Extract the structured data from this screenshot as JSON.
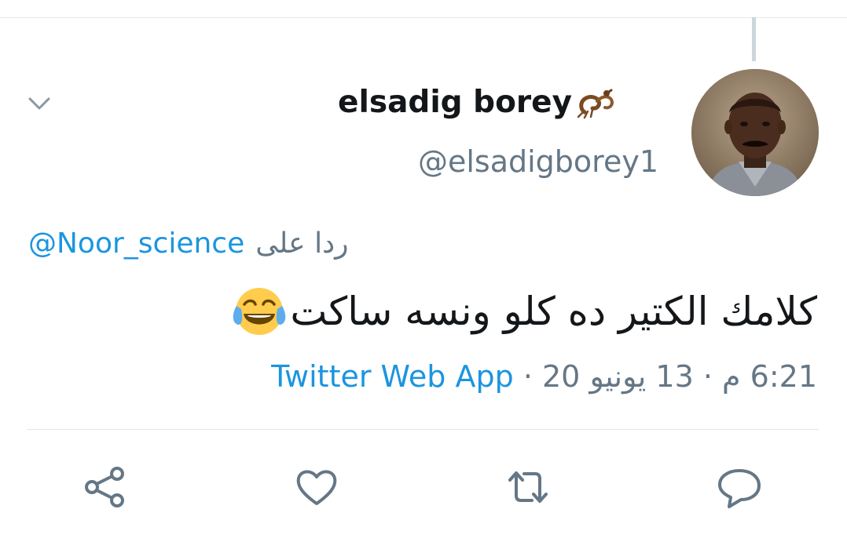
{
  "tweet": {
    "display_name": "elsadig borey",
    "handle": "@elsadigborey1",
    "reply_prefix": "ردا على",
    "reply_to": "@Noor_science",
    "text": "كلامك الكتير ده كلو ونسه ساكت",
    "time": "6:21 م",
    "date": "13 يونيو 20",
    "source": "Twitter Web App",
    "separator": "·",
    "name_badge_icon": "scorpion-icon",
    "text_emoji_icon": "face-with-tears-of-joy-icon"
  },
  "actions": [
    {
      "name": "share-icon"
    },
    {
      "name": "like-heart-icon"
    },
    {
      "name": "retweet-icon"
    },
    {
      "name": "reply-bubble-icon"
    }
  ],
  "colors": {
    "link": "#1b95e0",
    "secondary_text": "#657786",
    "primary_text": "#14171a",
    "divider": "#e1e8ed",
    "icon": "#657786"
  }
}
